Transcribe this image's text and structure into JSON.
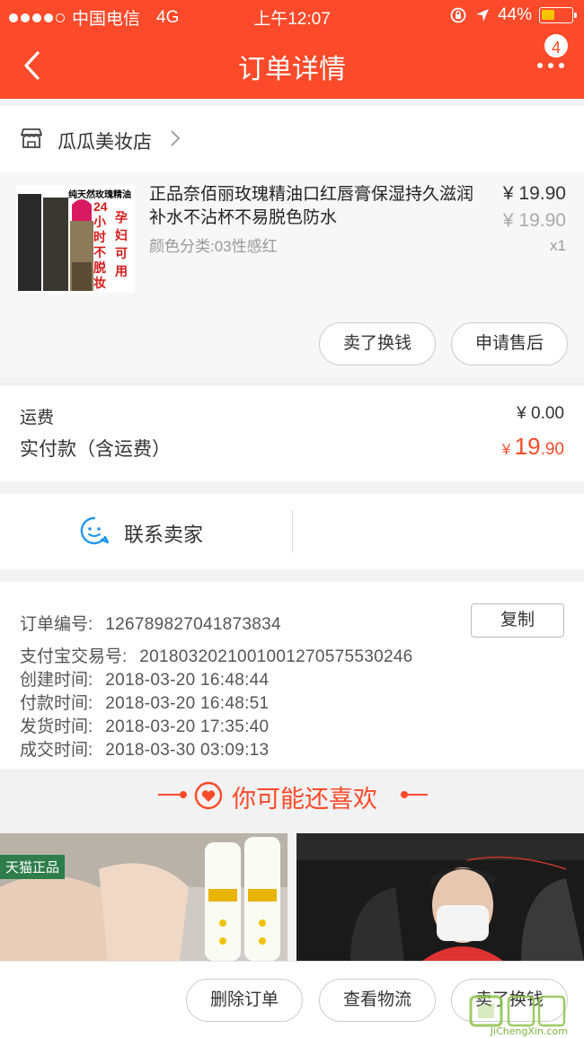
{
  "status_bar": {
    "carrier": "中国电信",
    "network": "4G",
    "time": "上午12:07",
    "battery": "44%",
    "battery_level": 0.44
  },
  "nav": {
    "title": "订单详情",
    "badge_count": "4"
  },
  "shop": {
    "name": "瓜瓜美妆店"
  },
  "product": {
    "thumbnail_text": "纯天然玫瑰精油",
    "thumbnail_text_2": "24小时不脱妆",
    "thumbnail_text_3": "孕妇可用",
    "title": "正品奈佰丽玫瑰精油口红唇膏保湿持久滋润补水不沾杯不易脱色防水",
    "spec": "颜色分类:03性感红",
    "price": "¥ 19.90",
    "original_price": "¥ 19.90",
    "quantity": "x1",
    "actions": [
      "卖了换钱",
      "申请售后"
    ]
  },
  "fees": {
    "shipping_label": "运费",
    "shipping_value": "¥ 0.00",
    "total_label": "实付款（含运费）",
    "total_yen": "¥",
    "total_int": "19",
    "total_dec": ".90"
  },
  "contact": {
    "label": "联系卖家"
  },
  "order_info": {
    "order_no_label": "订单编号:",
    "order_no": "126789827041873834",
    "copy_label": "复制",
    "alipay_label": "支付宝交易号:",
    "alipay_no": "2018032021001001270575530246",
    "created_label": "创建时间:",
    "created": "2018-03-20 16:48:44",
    "paid_label": "付款时间:",
    "paid": "2018-03-20 16:48:51",
    "shipped_label": "发货时间:",
    "shipped": "2018-03-20 17:35:40",
    "closed_label": "成交时间:",
    "closed": "2018-03-30 03:09:13"
  },
  "recommend": {
    "title": "你可能还喜欢",
    "tmall_tag": "天猫正品"
  },
  "bottom_actions": [
    "删除订单",
    "查看物流",
    "卖了换钱"
  ],
  "watermark": {
    "text": "JiChengXin.com"
  },
  "colors": {
    "brand": "#fd4a2a",
    "background": "#f2f2f2"
  }
}
